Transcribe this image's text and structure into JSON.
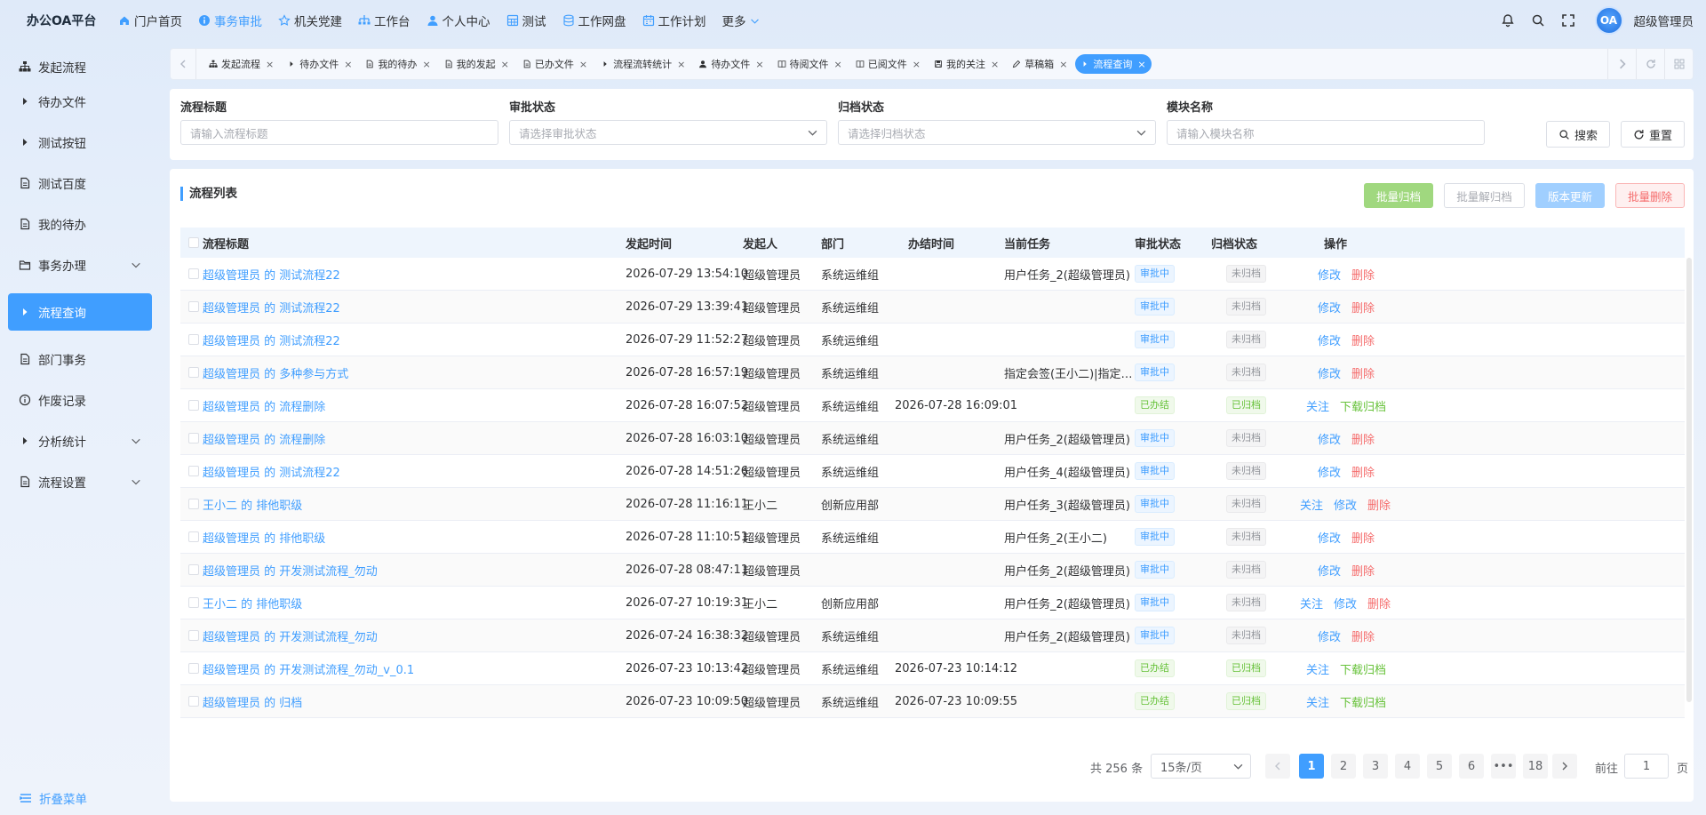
{
  "app": {
    "brand": "办公OA平台",
    "username": "超级管理员",
    "avatar_text": "OA"
  },
  "topnav": [
    {
      "label": "门户首页",
      "icon": "home-icon"
    },
    {
      "label": "事务审批",
      "icon": "info-icon",
      "active": true
    },
    {
      "label": "机关党建",
      "icon": "star-icon"
    },
    {
      "label": "工作台",
      "icon": "workbench-icon"
    },
    {
      "label": "个人中心",
      "icon": "user-icon"
    },
    {
      "label": "测试",
      "icon": "grid-icon"
    },
    {
      "label": "工作网盘",
      "icon": "database-icon"
    },
    {
      "label": "工作计划",
      "icon": "calendar-icon"
    },
    {
      "label": "更多",
      "icon": "chevron-down-icon"
    }
  ],
  "sidebar": {
    "items": [
      {
        "label": "发起流程",
        "icon": "sitemap-icon"
      },
      {
        "label": "待办文件",
        "icon": "caret-right-icon"
      },
      {
        "label": "测试按钮",
        "icon": "caret-right-icon"
      },
      {
        "label": "测试百度",
        "icon": "document-icon"
      },
      {
        "label": "我的待办",
        "icon": "document-icon"
      },
      {
        "label": "事务办理",
        "icon": "folder-icon",
        "expandable": true
      },
      {
        "label": "流程查询",
        "icon": "caret-right-icon",
        "active": true
      },
      {
        "label": "部门事务",
        "icon": "document-icon"
      },
      {
        "label": "作废记录",
        "icon": "info-circle-icon"
      },
      {
        "label": "分析统计",
        "icon": "caret-right-icon",
        "expandable": true
      },
      {
        "label": "流程设置",
        "icon": "document-icon",
        "expandable": true
      }
    ],
    "collapse_label": "折叠菜单"
  },
  "tabs": [
    {
      "label": "发起流程",
      "icon": "sitemap-icon"
    },
    {
      "label": "待办文件",
      "icon": "caret-right-icon"
    },
    {
      "label": "我的待办",
      "icon": "document-icon"
    },
    {
      "label": "我的发起",
      "icon": "document-icon"
    },
    {
      "label": "已办文件",
      "icon": "document-icon"
    },
    {
      "label": "流程流转统计",
      "icon": "caret-right-icon"
    },
    {
      "label": "待办文件",
      "icon": "user-icon"
    },
    {
      "label": "待阅文件",
      "icon": "book-icon"
    },
    {
      "label": "已阅文件",
      "icon": "book-icon"
    },
    {
      "label": "我的关注",
      "icon": "save-icon"
    },
    {
      "label": "草稿箱",
      "icon": "pen-icon"
    },
    {
      "label": "流程查询",
      "icon": "caret-right-icon",
      "active": true
    }
  ],
  "search": {
    "fields": [
      {
        "label": "流程标题",
        "placeholder": "请输入流程标题",
        "type": "input"
      },
      {
        "label": "审批状态",
        "placeholder": "请选择审批状态",
        "type": "select"
      },
      {
        "label": "归档状态",
        "placeholder": "请选择归档状态",
        "type": "select"
      },
      {
        "label": "模块名称",
        "placeholder": "请输入模块名称",
        "type": "input"
      }
    ],
    "search_label": "搜索",
    "reset_label": "重置"
  },
  "list": {
    "title": "流程列表",
    "actions": {
      "batch_archive": "批量归档",
      "batch_unarchive": "批量解归档",
      "version_update": "版本更新",
      "batch_delete": "批量删除"
    },
    "columns": [
      "流程标题",
      "发起时间",
      "发起人",
      "部门",
      "办结时间",
      "当前任务",
      "审批状态",
      "归档状态",
      "操作"
    ],
    "rows": [
      {
        "title": "超级管理员 的 测试流程22",
        "start": "2026-07-29 13:54:10",
        "initiator": "超级管理员",
        "dept": "系统运维组",
        "end": "",
        "task": "用户任务_2(超级管理员)",
        "approval": "审批中",
        "archive": "未归档",
        "ops": [
          "修改",
          "删除"
        ]
      },
      {
        "title": "超级管理员 的 测试流程22",
        "start": "2026-07-29 13:39:41",
        "initiator": "超级管理员",
        "dept": "系统运维组",
        "end": "",
        "task": "",
        "approval": "审批中",
        "archive": "未归档",
        "ops": [
          "修改",
          "删除"
        ]
      },
      {
        "title": "超级管理员 的 测试流程22",
        "start": "2026-07-29 11:52:27",
        "initiator": "超级管理员",
        "dept": "系统运维组",
        "end": "",
        "task": "",
        "approval": "审批中",
        "archive": "未归档",
        "ops": [
          "修改",
          "删除"
        ]
      },
      {
        "title": "超级管理员 的 多种参与方式",
        "start": "2026-07-28 16:57:19",
        "initiator": "超级管理员",
        "dept": "系统运维组",
        "end": "",
        "task": "指定会签(王小二)|指定会...",
        "approval": "审批中",
        "archive": "未归档",
        "ops": [
          "修改",
          "删除"
        ]
      },
      {
        "title": "超级管理员 的 流程删除",
        "start": "2026-07-28 16:07:52",
        "initiator": "超级管理员",
        "dept": "系统运维组",
        "end": "2026-07-28 16:09:01",
        "task": "",
        "approval": "已办结",
        "archive": "已归档",
        "ops": [
          "关注",
          "下载归档"
        ]
      },
      {
        "title": "超级管理员 的 流程删除",
        "start": "2026-07-28 16:03:10",
        "initiator": "超级管理员",
        "dept": "系统运维组",
        "end": "",
        "task": "用户任务_2(超级管理员)",
        "approval": "审批中",
        "archive": "未归档",
        "ops": [
          "修改",
          "删除"
        ]
      },
      {
        "title": "超级管理员 的 测试流程22",
        "start": "2026-07-28 14:51:26",
        "initiator": "超级管理员",
        "dept": "系统运维组",
        "end": "",
        "task": "用户任务_4(超级管理员)",
        "approval": "审批中",
        "archive": "未归档",
        "ops": [
          "修改",
          "删除"
        ]
      },
      {
        "title": "王小二 的 排他职级",
        "start": "2026-07-28 11:16:11",
        "initiator": "王小二",
        "dept": "创新应用部",
        "end": "",
        "task": "用户任务_3(超级管理员)",
        "approval": "审批中",
        "archive": "未归档",
        "ops": [
          "关注",
          "修改",
          "删除"
        ]
      },
      {
        "title": "超级管理员 的 排他职级",
        "start": "2026-07-28 11:10:51",
        "initiator": "超级管理员",
        "dept": "系统运维组",
        "end": "",
        "task": "用户任务_2(王小二)",
        "approval": "审批中",
        "archive": "未归档",
        "ops": [
          "修改",
          "删除"
        ]
      },
      {
        "title": "超级管理员 的 开发测试流程_勿动",
        "start": "2026-07-28 08:47:11",
        "initiator": "超级管理员",
        "dept": "",
        "end": "",
        "task": "用户任务_2(超级管理员)",
        "approval": "审批中",
        "archive": "未归档",
        "ops": [
          "修改",
          "删除"
        ]
      },
      {
        "title": "王小二 的 排他职级",
        "start": "2026-07-27 10:19:31",
        "initiator": "王小二",
        "dept": "创新应用部",
        "end": "",
        "task": "用户任务_2(超级管理员)",
        "approval": "审批中",
        "archive": "未归档",
        "ops": [
          "关注",
          "修改",
          "删除"
        ]
      },
      {
        "title": "超级管理员 的 开发测试流程_勿动",
        "start": "2026-07-24 16:38:32",
        "initiator": "超级管理员",
        "dept": "系统运维组",
        "end": "",
        "task": "用户任务_2(超级管理员)",
        "approval": "审批中",
        "archive": "未归档",
        "ops": [
          "修改",
          "删除"
        ]
      },
      {
        "title": "超级管理员 的 开发测试流程_勿动_v_0.1",
        "start": "2026-07-23 10:13:42",
        "initiator": "超级管理员",
        "dept": "系统运维组",
        "end": "2026-07-23 10:14:12",
        "task": "",
        "approval": "已办结",
        "archive": "已归档",
        "ops": [
          "关注",
          "下载归档"
        ]
      },
      {
        "title": "超级管理员 的 归档",
        "start": "2026-07-23 10:09:50",
        "initiator": "超级管理员",
        "dept": "系统运维组",
        "end": "2026-07-23 10:09:55",
        "task": "",
        "approval": "已办结",
        "archive": "已归档",
        "ops": [
          "关注",
          "下载归档"
        ]
      }
    ]
  },
  "pagination": {
    "total_text": "共 256 条",
    "page_size": "15条/页",
    "pages": [
      "1",
      "2",
      "3",
      "4",
      "5",
      "6",
      "•••",
      "18"
    ],
    "current": "1",
    "goto_label": "前往",
    "goto_value": "1",
    "page_suffix": "页"
  },
  "colors": {
    "primary": "#409eff",
    "success": "#67c23a",
    "danger": "#f56c6c",
    "info": "#909399"
  }
}
